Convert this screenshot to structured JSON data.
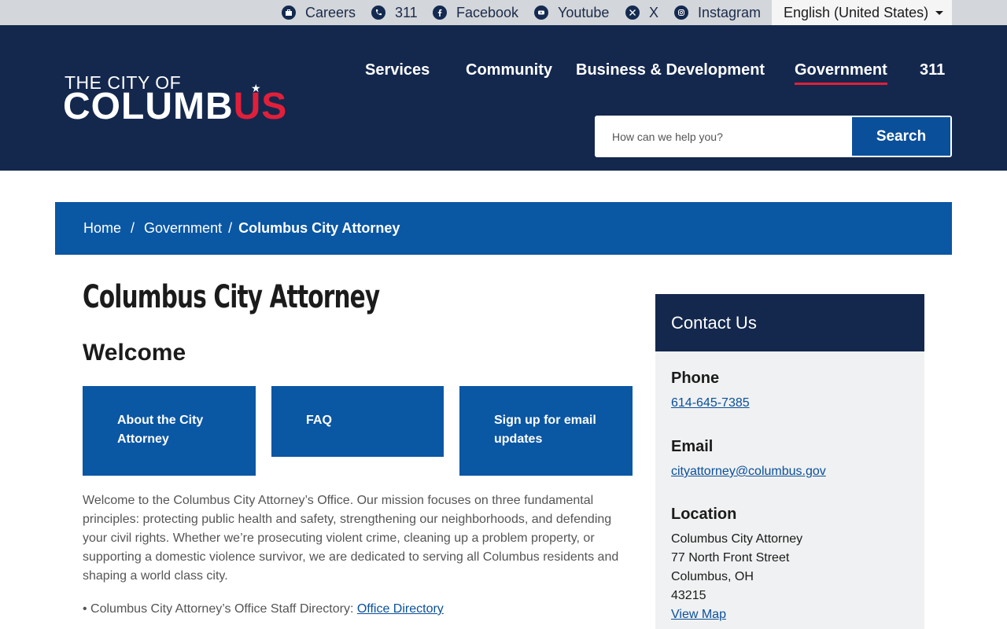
{
  "utility": {
    "links": [
      {
        "label": "Careers",
        "icon": "briefcase-icon"
      },
      {
        "label": "311",
        "icon": "phone-icon"
      },
      {
        "label": "Facebook",
        "icon": "facebook-icon"
      },
      {
        "label": "Youtube",
        "icon": "youtube-icon"
      },
      {
        "label": "X",
        "icon": "x-icon"
      },
      {
        "label": "Instagram",
        "icon": "instagram-icon"
      }
    ],
    "language": "English (United States)"
  },
  "header": {
    "logo": {
      "line1": "THE CITY OF",
      "line2_white": "COLUMB",
      "line2_red": "US"
    },
    "nav": [
      "Services",
      "Community",
      "Business & Development",
      "Government",
      "311"
    ],
    "active_nav": "Government",
    "search": {
      "placeholder": "How can we help you?",
      "button": "Search"
    }
  },
  "breadcrumb": {
    "items": [
      "Home",
      "Government"
    ],
    "current": "Columbus City Attorney"
  },
  "main": {
    "title": "Columbus City Attorney",
    "heading": "Welcome",
    "tiles": [
      "About the City Attorney",
      "FAQ",
      "Sign up for email updates"
    ],
    "intro": "Welcome to the Columbus City Attorney’s Office. Our mission focuses on three fundamental principles: protecting public health and safety, strengthening our neighborhoods, and defending your civil rights. Whether we’re prosecuting violent crime, cleaning up a problem property, or supporting a domestic violence survivor, we are dedicated to serving all Columbus residents and shaping a world class city.",
    "staff_prefix": "• Columbus City Attorney’s Office Staff Directory: ",
    "staff_link": "Office Directory"
  },
  "contact": {
    "title": "Contact Us",
    "phone_label": "Phone",
    "phone": "614-645-7385",
    "email_label": "Email",
    "email": "cityattorney@columbus.gov",
    "location_label": "Location",
    "address": [
      "Columbus City Attorney",
      "77 North Front Street",
      "Columbus, OH",
      "43215"
    ],
    "map_link": "View Map"
  },
  "colors": {
    "navy": "#14284e",
    "blue": "#0a57a4",
    "red": "#e21f3a"
  }
}
